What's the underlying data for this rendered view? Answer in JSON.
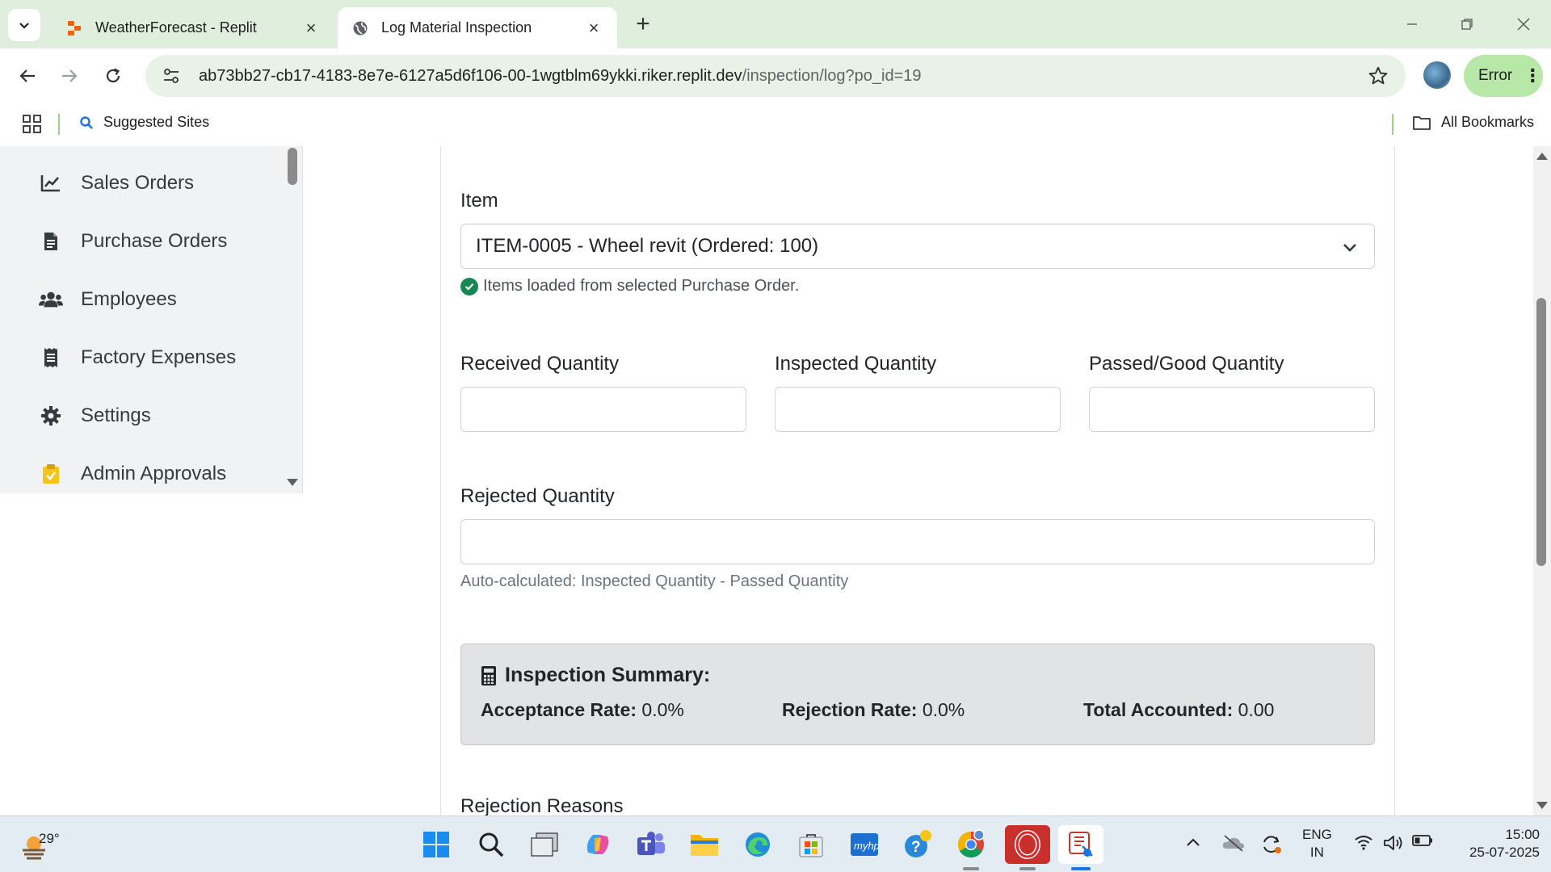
{
  "browser": {
    "tabs": [
      {
        "title": "WeatherForecast - Replit",
        "active": false
      },
      {
        "title": "Log Material Inspection",
        "active": true
      }
    ],
    "url_host": "ab73bb27-cb17-4183-8e7e-6127a5d6f106-00-1wgtblm69ykki.riker.replit.dev",
    "url_path": "/inspection/log?po_id=19",
    "error_label": "Error",
    "bookmarks": {
      "suggested": "Suggested Sites",
      "all": "All Bookmarks"
    }
  },
  "sidebar": {
    "items": [
      {
        "label": "Sales Orders",
        "icon": "chart-line-icon"
      },
      {
        "label": "Purchase Orders",
        "icon": "file-invoice-icon"
      },
      {
        "label": "Employees",
        "icon": "users-icon"
      },
      {
        "label": "Factory Expenses",
        "icon": "receipt-icon"
      },
      {
        "label": "Settings",
        "icon": "gear-icon"
      },
      {
        "label": "Admin Approvals",
        "icon": "clipboard-check-icon"
      }
    ]
  },
  "form": {
    "item_label": "Item",
    "item_selected": "ITEM-0005 - Wheel revit (Ordered: 100)",
    "items_loaded_message": "Items loaded from selected Purchase Order.",
    "received_label": "Received Quantity",
    "received_value": "",
    "inspected_label": "Inspected Quantity",
    "inspected_value": "",
    "passed_label": "Passed/Good Quantity",
    "passed_value": "",
    "rejected_label": "Rejected Quantity",
    "rejected_value": "",
    "rejected_help": "Auto-calculated: Inspected Quantity - Passed Quantity",
    "summary": {
      "title": "Inspection Summary:",
      "acceptance_label": "Acceptance Rate:",
      "acceptance_value": "0.0%",
      "rejection_label": "Rejection Rate:",
      "rejection_value": "0.0%",
      "total_label": "Total Accounted:",
      "total_value": "0.00"
    },
    "rejection_reasons_label": "Rejection Reasons"
  },
  "taskbar": {
    "weather_temp": "29°",
    "lang_line1": "ENG",
    "lang_line2": "IN",
    "time": "15:00",
    "date": "25-07-2025"
  },
  "colors": {
    "chrome_bg": "#dfeedd",
    "success": "#198754",
    "summary_bg": "#e2e3e5",
    "error_pill": "#b7e8a8"
  }
}
